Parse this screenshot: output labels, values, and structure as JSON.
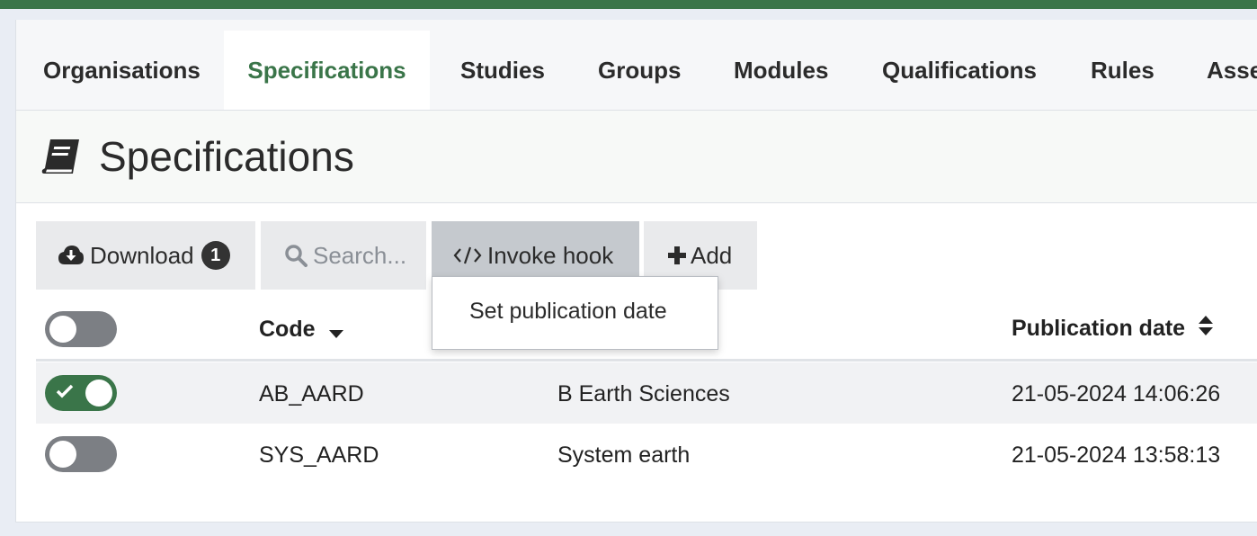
{
  "tabs": [
    {
      "label": "Organisations",
      "active": false
    },
    {
      "label": "Specifications",
      "active": true
    },
    {
      "label": "Studies",
      "active": false
    },
    {
      "label": "Groups",
      "active": false
    },
    {
      "label": "Modules",
      "active": false
    },
    {
      "label": "Qualifications",
      "active": false
    },
    {
      "label": "Rules",
      "active": false
    },
    {
      "label": "Assessments",
      "active": false
    }
  ],
  "page": {
    "title": "Specifications",
    "icon": "book-icon"
  },
  "toolbar": {
    "download_label": "Download",
    "download_count": "1",
    "search_placeholder": "Search...",
    "invoke_label": "Invoke hook",
    "add_label": "Add"
  },
  "dropdown": {
    "items": [
      "Set publication date"
    ]
  },
  "table": {
    "columns": {
      "code": "Code",
      "publication_date": "Publication date"
    },
    "rows": [
      {
        "selected": true,
        "code": "AB_AARD",
        "name": "B Earth Sciences",
        "publication_date": "21-05-2024 14:06:26"
      },
      {
        "selected": false,
        "code": "SYS_AARD",
        "name": "System earth",
        "publication_date": "21-05-2024 13:58:13"
      }
    ]
  },
  "colors": {
    "accent": "#3a7549",
    "toggle_off": "#7c7f84",
    "button_bg": "#e9eaec",
    "button_active_bg": "#c5c9ce"
  }
}
